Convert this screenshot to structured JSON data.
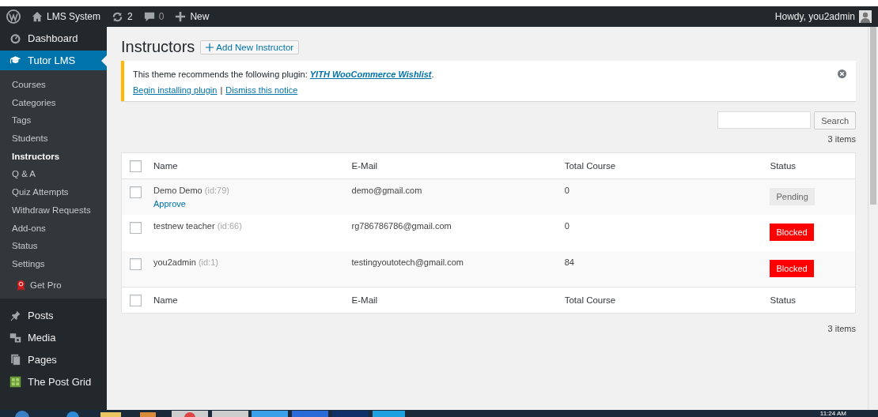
{
  "admin_bar": {
    "site": "LMS System",
    "updates": "2",
    "comments": "0",
    "new": "New",
    "greeting": "Howdy, you2admin"
  },
  "sidebar": {
    "items": [
      {
        "label": "Dashboard",
        "selected": false
      },
      {
        "label": "Tutor LMS",
        "selected": true,
        "children": [
          {
            "label": "Courses",
            "selected": false,
            "kind": "link"
          },
          {
            "label": "Categories",
            "selected": false,
            "kind": "link"
          },
          {
            "label": "Tags",
            "selected": false,
            "kind": "link"
          },
          {
            "label": "Students",
            "selected": false,
            "kind": "link"
          },
          {
            "label": "Instructors",
            "selected": true,
            "kind": "link"
          },
          {
            "label": "Q & A",
            "selected": false,
            "kind": "link"
          },
          {
            "label": "Quiz Attempts",
            "selected": false,
            "kind": "link"
          },
          {
            "label": "Withdraw Requests",
            "selected": false,
            "kind": "link"
          },
          {
            "label": "Add-ons",
            "selected": false,
            "kind": "link"
          },
          {
            "label": "Status",
            "selected": false,
            "kind": "link"
          },
          {
            "label": "Settings",
            "selected": false,
            "kind": "link"
          },
          {
            "label": "Get Pro",
            "selected": false,
            "kind": "promo"
          }
        ]
      },
      {
        "label": "Posts",
        "selected": false
      },
      {
        "label": "Media",
        "selected": false
      },
      {
        "label": "Pages",
        "selected": false
      },
      {
        "label": "The Post Grid",
        "selected": false
      }
    ]
  },
  "page": {
    "title": "Instructors",
    "add_button": "Add New Instructor"
  },
  "notice": {
    "text": "This theme recommends the following plugin: ",
    "plugin_link": "YITH WooCommerce Wishlist",
    "text_end": ".",
    "install_link": "Begin installing plugin",
    "separator": "|",
    "dismiss_link": "Dismiss this notice"
  },
  "search": {
    "button": "Search"
  },
  "items_count_top": "3 items",
  "table": {
    "select_all_checked": false,
    "footer_select_all_checked": false,
    "columns": [
      "Name",
      "E-Mail",
      "Total Course",
      "Status"
    ],
    "rows": [
      {
        "checked": false,
        "name": "Demo Demo",
        "id": "(id:79)",
        "action": "Approve",
        "email": "demo@gmail.com",
        "total": "0",
        "status": {
          "label": "Pending",
          "kind": "pending"
        }
      },
      {
        "checked": false,
        "name": "testnew teacher",
        "id": "(id:66)",
        "email": "rg786786786@gmail.com",
        "total": "0",
        "status": {
          "label": "Blocked",
          "kind": "blocked"
        }
      },
      {
        "checked": false,
        "name": "you2admin",
        "id": "(id:1)",
        "email": "testingyoutotech@gmail.com",
        "total": "84",
        "status": {
          "label": "Blocked",
          "kind": "blocked"
        }
      }
    ],
    "footer_columns": [
      "Name",
      "E-Mail",
      "Total Course",
      "Status"
    ]
  },
  "items_count_bottom": "3 items",
  "taskbar": {
    "clock": "11:24 AM"
  }
}
